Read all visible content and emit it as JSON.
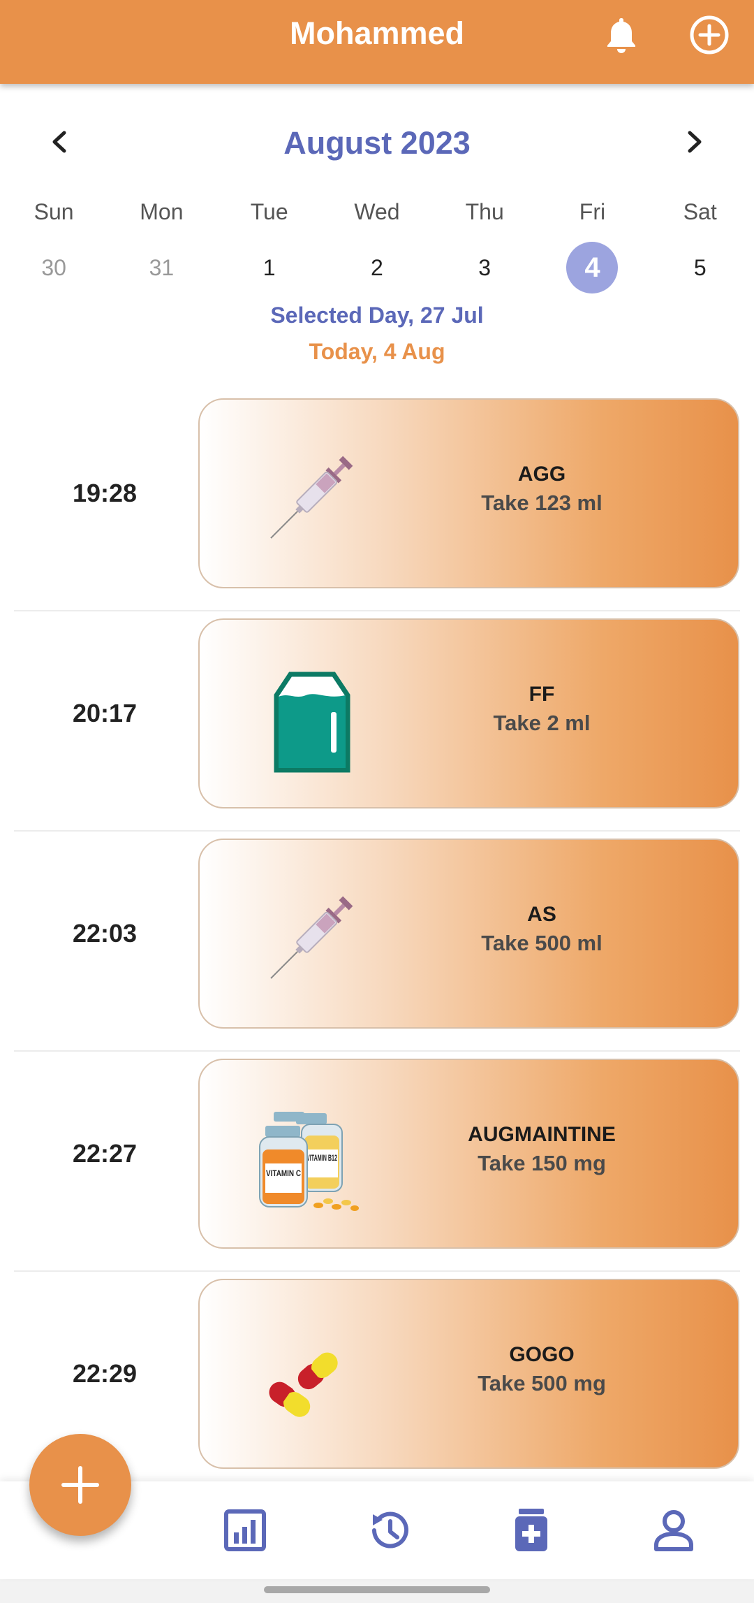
{
  "header": {
    "title": "Mohammed",
    "bell_icon": "bell-icon",
    "add_icon": "plus-circle-icon",
    "color": "#E8914A"
  },
  "calendar": {
    "month": "August 2023",
    "weekdays": [
      "Sun",
      "Mon",
      "Tue",
      "Wed",
      "Thu",
      "Fri",
      "Sat"
    ],
    "days": [
      "30",
      "31",
      "1",
      "2",
      "3",
      "4",
      "5"
    ],
    "selected_day_text": "Selected Day, 27 Jul",
    "today_text": "Today, 4 Aug"
  },
  "schedule": [
    {
      "time": "19:28",
      "name": "AGG",
      "dose": "Take 123 ml",
      "icon": "syringe-icon"
    },
    {
      "time": "20:17",
      "name": "FF",
      "dose": "Take 2 ml",
      "icon": "bottle-icon"
    },
    {
      "time": "22:03",
      "name": "AS",
      "dose": "Take 500 ml",
      "icon": "syringe-icon"
    },
    {
      "time": "22:27",
      "name": "AUGMAINTINE",
      "dose": "Take 150 mg",
      "icon": "vitamin-bottles-icon"
    },
    {
      "time": "22:29",
      "name": "GOGO",
      "dose": "Take 500 mg",
      "icon": "capsules-icon"
    }
  ],
  "vitamin_labels": {
    "c": "VITAMIN C",
    "b": "VITAMIN B12"
  },
  "bottom_nav": [
    "stats-icon",
    "history-icon",
    "medicine-icon",
    "profile-icon"
  ],
  "colors": {
    "accent": "#E8914A",
    "primary": "#5B68B8",
    "selected_circle": "#9CA4DF"
  }
}
